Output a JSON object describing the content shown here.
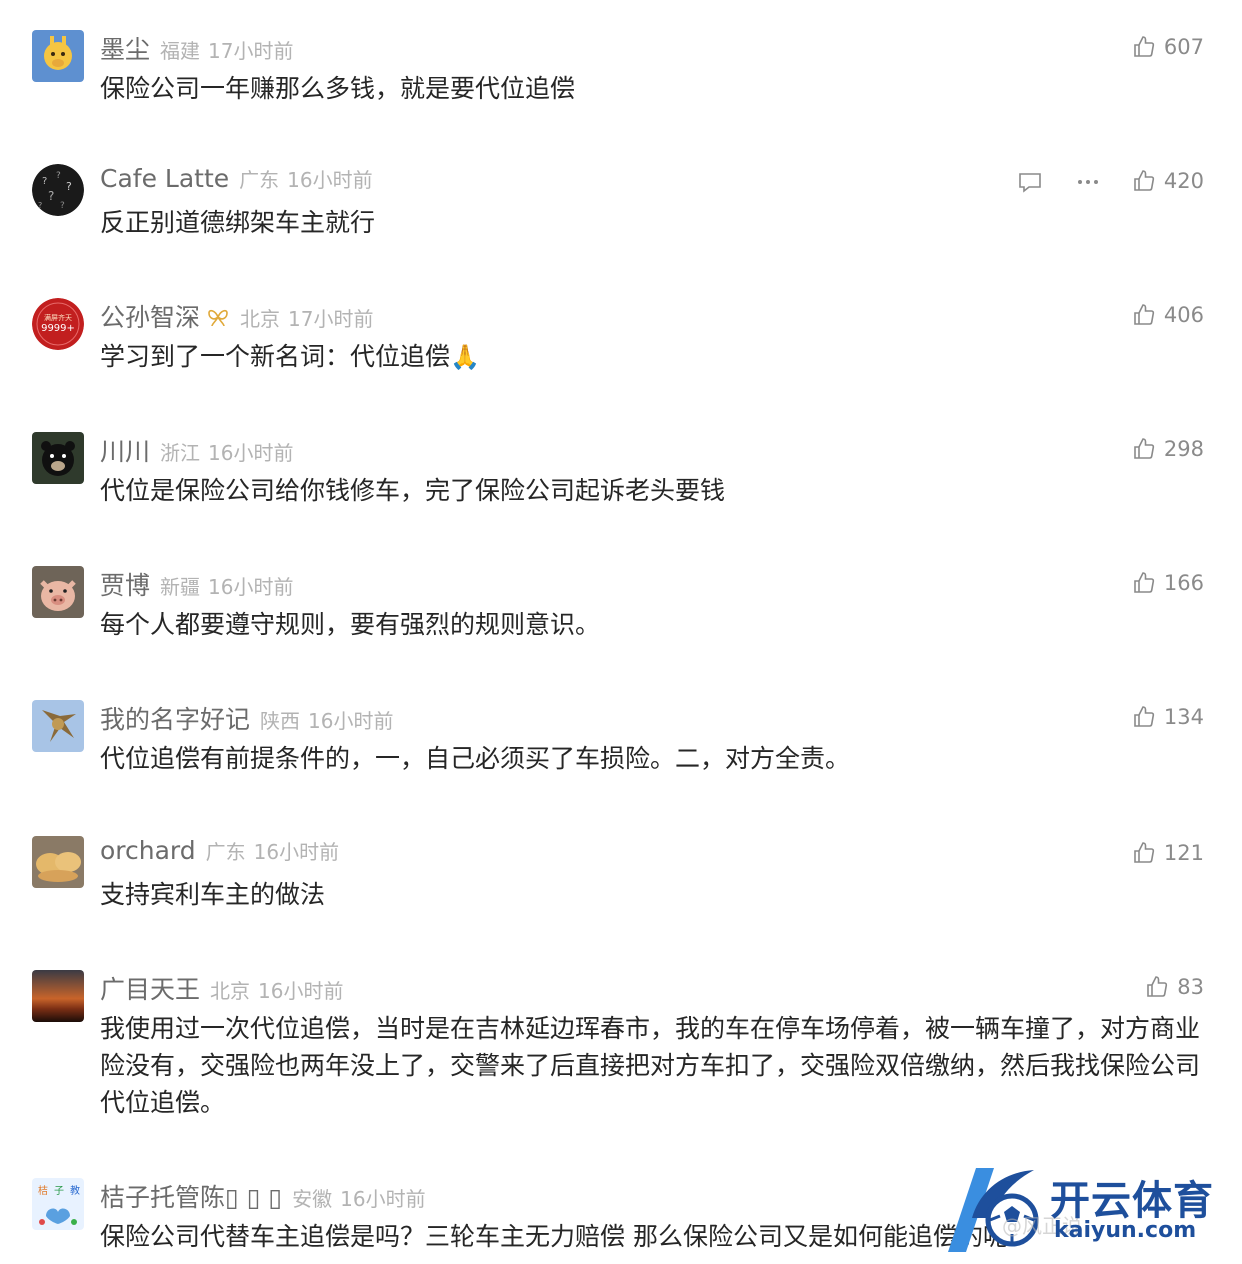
{
  "comments": [
    {
      "name": "墨尘",
      "location": "福建",
      "time": "17小时前",
      "text": "保险公司一年赚那么多钱，就是要代位追偿",
      "likes": "607"
    },
    {
      "name": "Cafe Latte",
      "location": "广东",
      "time": "16小时前",
      "text": "反正别道德绑架车主就行",
      "likes": "420"
    },
    {
      "name": "公孙智深",
      "location": "北京",
      "time": "17小时前",
      "text": "学习到了一个新名词：代位追偿",
      "emoji": "🙏",
      "likes": "406"
    },
    {
      "name": "川川",
      "location": "浙江",
      "time": "16小时前",
      "text": "代位是保险公司给你钱修车，完了保险公司起诉老头要钱",
      "likes": "298"
    },
    {
      "name": "贾博",
      "location": "新疆",
      "time": "16小时前",
      "text": "每个人都要遵守规则，要有强烈的规则意识。",
      "likes": "166"
    },
    {
      "name": "我的名字好记",
      "location": "陕西",
      "time": "16小时前",
      "text": "代位追偿有前提条件的，一，自己必须买了车损险。二，对方全责。",
      "likes": "134"
    },
    {
      "name": "orchard",
      "location": "广东",
      "time": "16小时前",
      "text": "支持宾利车主的做法",
      "likes": "121"
    },
    {
      "name": "广目天王",
      "location": "北京",
      "time": "16小时前",
      "text": "我使用过一次代位追偿，当时是在吉林延边珲春市，我的车在停车场停着，被一辆车撞了，对方商业险没有，交强险也两年没上了，交警来了后直接把对方车扣了，交强险双倍缴纳，然后我找保险公司代位追偿。",
      "likes": "83"
    },
    {
      "name": "桔子托管陈▯ ▯ ▯",
      "location": "安徽",
      "time": "16小时前",
      "text": "保险公司代替车主追偿是吗？三轮车主无力赔偿 那么保险公司又是如何能追偿的呢？",
      "likes": ""
    }
  ],
  "avatar_text": {
    "c3": "满屏齐天",
    "c3_num": "9999+"
  },
  "watermark": {
    "brand": "开云体育",
    "url": "kaiyun.com",
    "faded": "@风正说"
  },
  "colors": {
    "name": "#6b6b6b",
    "meta": "#b3b3b3",
    "text": "#262626",
    "brand": "#1e4f9c"
  },
  "icons": {
    "like": "thumbs-up-icon",
    "reply": "comment-icon",
    "more": "more-icon"
  }
}
